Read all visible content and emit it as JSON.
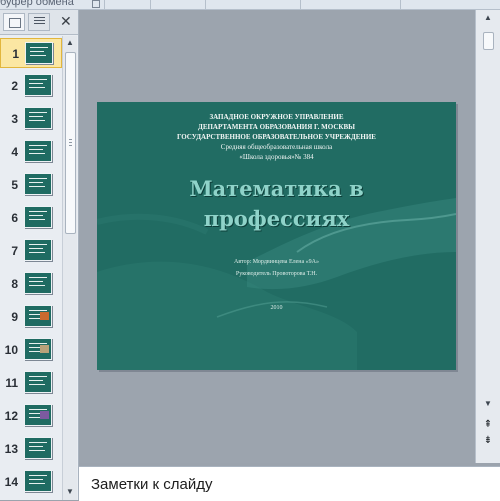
{
  "ribbon": {
    "clipboard_group_label": "буфер обмена"
  },
  "left_panel": {
    "tabs": [
      {
        "name": "slides",
        "selected": true
      },
      {
        "name": "outline",
        "selected": false
      }
    ],
    "close_glyph": "✕",
    "slides": [
      {
        "number": "1",
        "selected": true
      },
      {
        "number": "2"
      },
      {
        "number": "3"
      },
      {
        "number": "4"
      },
      {
        "number": "5"
      },
      {
        "number": "6"
      },
      {
        "number": "7"
      },
      {
        "number": "8"
      },
      {
        "number": "9"
      },
      {
        "number": "10"
      },
      {
        "number": "11"
      },
      {
        "number": "12"
      },
      {
        "number": "13"
      },
      {
        "number": "14"
      }
    ]
  },
  "slide": {
    "header_line1": "ЗАПАДНОЕ  ОКРУЖНОЕ УПРАВЛЕНИЕ",
    "header_line2": "ДЕПАРТАМЕНТА ОБРАЗОВАНИЯ  Г. МОСКВЫ",
    "header_line3": "ГОСУДАРСТВЕННОЕ  ОБРАЗОВАТЕЛЬНОЕ  УЧРЕЖДЕНИЕ",
    "header_line4": "Средняя  общеобразовательная школа",
    "header_line5": "«Школа здоровья»№ 384",
    "title_line1": "Математика в",
    "title_line2": "профессиях",
    "author": "Автор:  Мордвинцева  Елена «9А»",
    "supervisor": "Руководитель  Провоторова  Т.Н.",
    "year": "2010",
    "background_color": "#216c63",
    "title_color": "#8fd3c9"
  },
  "notes": {
    "text": "Заметки к слайду"
  },
  "colors": {
    "workspace": "#9ba3ad",
    "selected_thumb": "#fbe7a3"
  }
}
